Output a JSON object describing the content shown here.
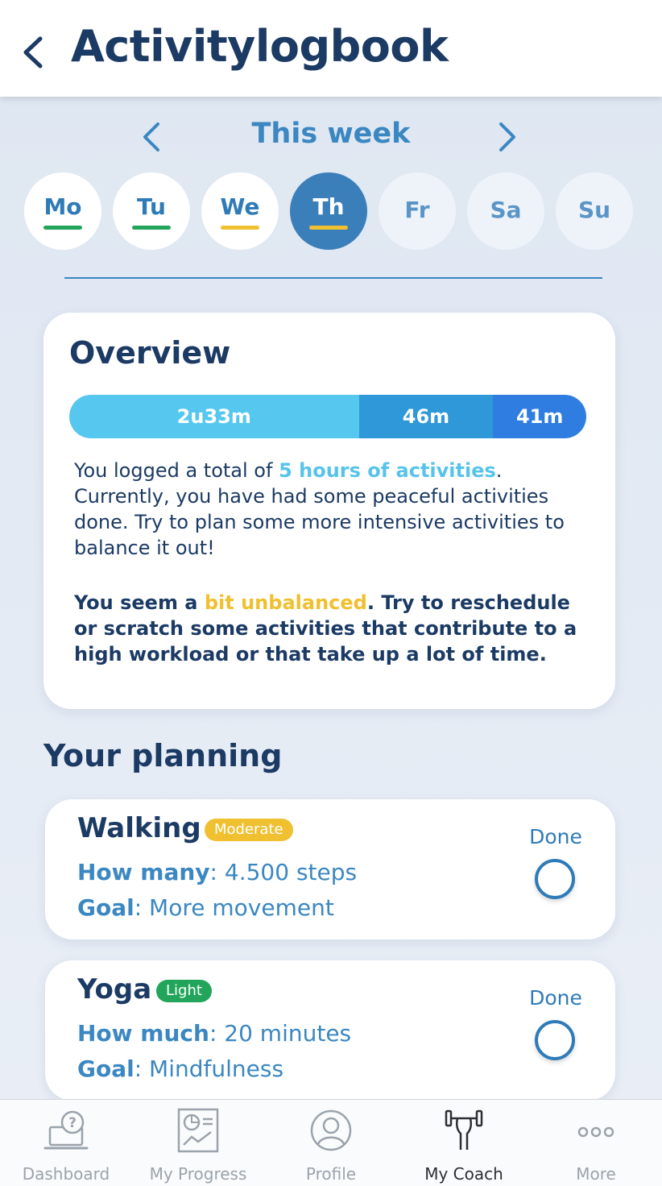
{
  "header": {
    "title": "Activitylogbook"
  },
  "week": {
    "label": "This week",
    "days": [
      {
        "label": "Mo",
        "state": "done",
        "underline_color": "#22a55a"
      },
      {
        "label": "Tu",
        "state": "done",
        "underline_color": "#22a55a"
      },
      {
        "label": "We",
        "state": "done",
        "underline_color": "#f0c030"
      },
      {
        "label": "Th",
        "state": "selected",
        "underline_color": "#f0c030"
      },
      {
        "label": "Fr",
        "state": "future",
        "underline_color": ""
      },
      {
        "label": "Sa",
        "state": "future",
        "underline_color": ""
      },
      {
        "label": "Su",
        "state": "future",
        "underline_color": ""
      }
    ]
  },
  "overview": {
    "title": "Overview",
    "bar": [
      {
        "label": "2u33m",
        "fraction": 0.56,
        "color": "#56c8f0"
      },
      {
        "label": "46m",
        "fraction": 0.26,
        "color": "#2e98d8"
      },
      {
        "label": "41m",
        "fraction": 0.18,
        "color": "#2f7de0"
      }
    ],
    "text1_prefix": "You logged a total of ",
    "text1_highlight": "5 hours of activities",
    "text1_suffix": ". Currently, you have had some peaceful activities done. Try to plan some more intensive activities to balance it out!",
    "text2_prefix": "You seem a ",
    "text2_highlight": "bit unbalanced",
    "text2_suffix": ". Try to reschedule or scratch some activities that contribute to a high workload or that take up a lot of time."
  },
  "planning": {
    "title": "Your planning",
    "items": [
      {
        "name": "Walking",
        "badge": "Moderate",
        "badge_color": "#f0c030",
        "line1_label": "How many",
        "line1_value": ": 4.500 steps",
        "goal_label": "Goal",
        "goal_value": ": More movement",
        "done_label": "Done"
      },
      {
        "name": "Yoga",
        "badge": "Light",
        "badge_color": "#22a55a",
        "line1_label": "How much",
        "line1_value": ": 20 minutes",
        "goal_label": "Goal",
        "goal_value": ": Mindfulness",
        "done_label": "Done"
      }
    ]
  },
  "tabbar": {
    "tabs": [
      {
        "label": "Dashboard",
        "icon": "laptop-question-icon"
      },
      {
        "label": "My Progress",
        "icon": "chart-report-icon"
      },
      {
        "label": "Profile",
        "icon": "user-circle-icon"
      },
      {
        "label": "My Coach",
        "icon": "dumbbell-arm-icon",
        "active": true
      },
      {
        "label": "More",
        "icon": "dots-icon"
      }
    ]
  },
  "colors": {
    "primary": "#1b3a64",
    "accent": "#3a87c2",
    "selected_day": "#3a7fba"
  }
}
